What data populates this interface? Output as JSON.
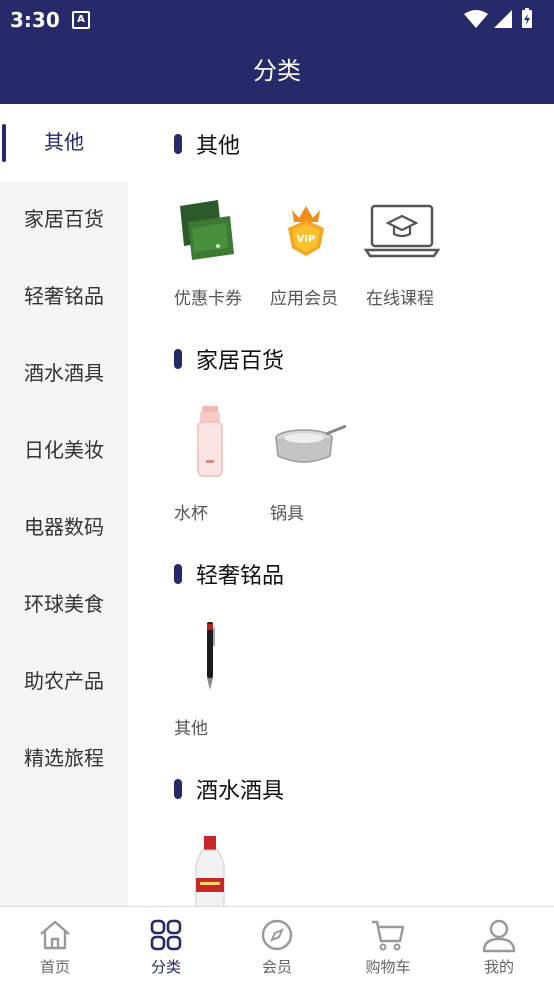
{
  "status": {
    "time": "3:30",
    "notif_icon": "A"
  },
  "appbar": {
    "title": "分类"
  },
  "sidebar": {
    "items": [
      {
        "label": "其他",
        "active": true
      },
      {
        "label": "家居百货"
      },
      {
        "label": "轻奢铭品"
      },
      {
        "label": "酒水酒具"
      },
      {
        "label": "日化美妆"
      },
      {
        "label": "电器数码"
      },
      {
        "label": "环球美食"
      },
      {
        "label": "助农产品"
      },
      {
        "label": "精选旅程"
      }
    ]
  },
  "sections": [
    {
      "title": "其他",
      "items": [
        {
          "label": "优惠卡券",
          "icon": "coupon-card-image"
        },
        {
          "label": "应用会员",
          "icon": "vip-crown-image"
        },
        {
          "label": "在线课程",
          "icon": "laptop-course-icon"
        }
      ]
    },
    {
      "title": "家居百货",
      "items": [
        {
          "label": "水杯",
          "icon": "water-bottle-image"
        },
        {
          "label": "锅具",
          "icon": "cooking-pot-image"
        }
      ]
    },
    {
      "title": "轻奢铭品",
      "items": [
        {
          "label": "其他",
          "icon": "pen-image"
        }
      ]
    },
    {
      "title": "酒水酒具",
      "items": [
        {
          "label": "",
          "icon": "liquor-bottle-image"
        }
      ]
    }
  ],
  "tabbar": {
    "items": [
      {
        "label": "首页",
        "icon": "home-icon"
      },
      {
        "label": "分类",
        "icon": "category-grid-icon",
        "active": true
      },
      {
        "label": "会员",
        "icon": "compass-icon"
      },
      {
        "label": "购物车",
        "icon": "cart-icon"
      },
      {
        "label": "我的",
        "icon": "user-icon"
      }
    ]
  },
  "colors": {
    "primary": "#262a6b",
    "sidebar_bg": "#f5f5f5"
  }
}
